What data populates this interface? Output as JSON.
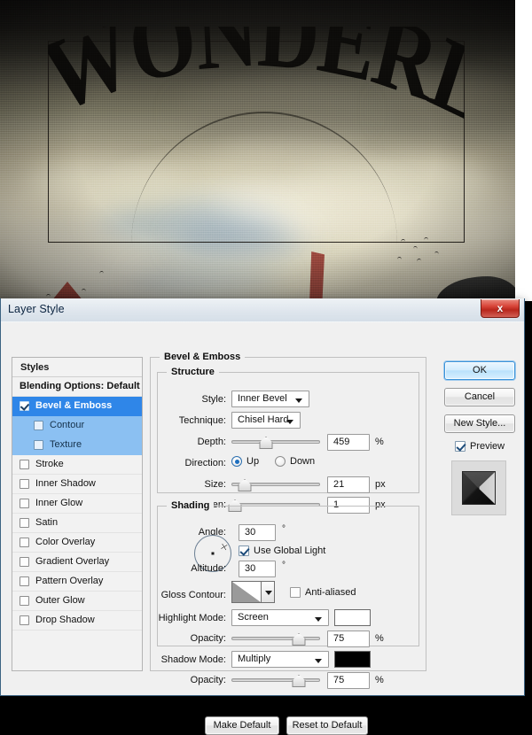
{
  "canvas": {
    "artwork_text": "WONDERLAND",
    "description": "Gothic WONDERLAND wordmark over a stormy sky with birds and a red sail"
  },
  "dialog": {
    "title": "Layer Style",
    "close_label": "x"
  },
  "styles_panel": {
    "header": "Styles",
    "items": [
      {
        "label": "Blending Options: Default",
        "checkbox": false,
        "has_checkbox": false,
        "bold": true,
        "indent": false,
        "state": "normal"
      },
      {
        "label": "Bevel & Emboss",
        "checkbox": true,
        "has_checkbox": true,
        "bold": true,
        "indent": false,
        "state": "selected"
      },
      {
        "label": "Contour",
        "checkbox": false,
        "has_checkbox": true,
        "bold": false,
        "indent": true,
        "state": "sub-selected"
      },
      {
        "label": "Texture",
        "checkbox": false,
        "has_checkbox": true,
        "bold": false,
        "indent": true,
        "state": "sub-selected"
      },
      {
        "label": "Stroke",
        "checkbox": false,
        "has_checkbox": true,
        "bold": false,
        "indent": false,
        "state": "normal"
      },
      {
        "label": "Inner Shadow",
        "checkbox": false,
        "has_checkbox": true,
        "bold": false,
        "indent": false,
        "state": "normal"
      },
      {
        "label": "Inner Glow",
        "checkbox": false,
        "has_checkbox": true,
        "bold": false,
        "indent": false,
        "state": "normal"
      },
      {
        "label": "Satin",
        "checkbox": false,
        "has_checkbox": true,
        "bold": false,
        "indent": false,
        "state": "normal"
      },
      {
        "label": "Color Overlay",
        "checkbox": false,
        "has_checkbox": true,
        "bold": false,
        "indent": false,
        "state": "normal"
      },
      {
        "label": "Gradient Overlay",
        "checkbox": false,
        "has_checkbox": true,
        "bold": false,
        "indent": false,
        "state": "normal"
      },
      {
        "label": "Pattern Overlay",
        "checkbox": false,
        "has_checkbox": true,
        "bold": false,
        "indent": false,
        "state": "normal"
      },
      {
        "label": "Outer Glow",
        "checkbox": false,
        "has_checkbox": true,
        "bold": false,
        "indent": false,
        "state": "normal"
      },
      {
        "label": "Drop Shadow",
        "checkbox": false,
        "has_checkbox": true,
        "bold": false,
        "indent": false,
        "state": "normal"
      }
    ]
  },
  "main": {
    "section_title": "Bevel & Emboss",
    "structure": {
      "title": "Structure",
      "style_label": "Style:",
      "style_value": "Inner Bevel",
      "technique_label": "Technique:",
      "technique_value": "Chisel Hard",
      "depth_label": "Depth:",
      "depth_value": "459",
      "depth_unit": "%",
      "depth_percent": 38,
      "direction_label": "Direction:",
      "direction_up": "Up",
      "direction_down": "Down",
      "direction_selected": "Up",
      "size_label": "Size:",
      "size_value": "21",
      "size_unit": "px",
      "size_percent": 14,
      "soften_label": "Soften:",
      "soften_value": "1",
      "soften_unit": "px",
      "soften_percent": 3
    },
    "shading": {
      "title": "Shading",
      "angle_label": "Angle:",
      "angle_value": "30",
      "angle_unit": "°",
      "use_global_light_label": "Use Global Light",
      "use_global_light": true,
      "altitude_label": "Altitude:",
      "altitude_value": "30",
      "altitude_unit": "°",
      "gloss_contour_label": "Gloss Contour:",
      "anti_aliased_label": "Anti-aliased",
      "anti_aliased": false,
      "highlight_mode_label": "Highlight Mode:",
      "highlight_mode_value": "Screen",
      "highlight_color": "#ffffff",
      "highlight_opacity_label": "Opacity:",
      "highlight_opacity_value": "75",
      "highlight_opacity_unit": "%",
      "highlight_opacity_percent": 75,
      "shadow_mode_label": "Shadow Mode:",
      "shadow_mode_value": "Multiply",
      "shadow_color": "#000000",
      "shadow_opacity_label": "Opacity:",
      "shadow_opacity_value": "75",
      "shadow_opacity_unit": "%",
      "shadow_opacity_percent": 75
    },
    "make_default_label": "Make Default",
    "reset_default_label": "Reset to Default"
  },
  "right_column": {
    "ok_label": "OK",
    "cancel_label": "Cancel",
    "new_style_label": "New Style...",
    "preview_label": "Preview",
    "preview_checked": true
  },
  "colors": {
    "accent": "#2f86e8",
    "sub_accent": "#8bc0f2",
    "dialog_bg": "#f0f0f0",
    "close_red": "#d9463a"
  }
}
